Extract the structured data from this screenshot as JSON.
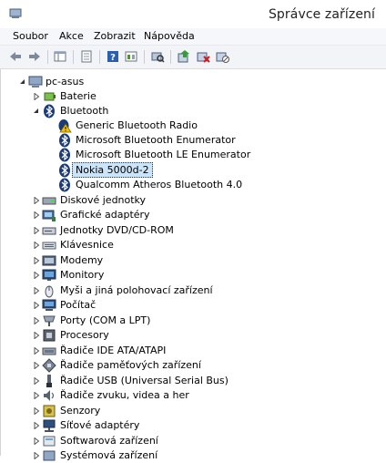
{
  "window": {
    "title": "Správce zařízení"
  },
  "menu": [
    "Soubor",
    "Akce",
    "Zobrazit",
    "Nápověda"
  ],
  "toolbar": {
    "buttons": [
      "back-icon",
      "forward-icon",
      "show-hide-tree-icon",
      "properties-icon",
      "help-icon",
      "action-view-icon",
      "scan-hardware-icon",
      "update-driver-icon",
      "uninstall-icon",
      "disable-icon"
    ]
  },
  "tree": {
    "root": "pc-asus",
    "items": [
      {
        "label": "Baterie",
        "icon": "battery-icon",
        "expanded": false
      },
      {
        "label": "Bluetooth",
        "icon": "bluetooth-icon",
        "expanded": true,
        "children": [
          {
            "label": "Generic Bluetooth Radio",
            "icon": "warning-icon"
          },
          {
            "label": "Microsoft Bluetooth Enumerator",
            "icon": "bluetooth-icon"
          },
          {
            "label": "Microsoft Bluetooth LE Enumerator",
            "icon": "bluetooth-icon"
          },
          {
            "label": "Nokia 5000d-2",
            "icon": "bluetooth-icon",
            "selected": true
          },
          {
            "label": "Qualcomm Atheros Bluetooth 4.0",
            "icon": "bluetooth-icon"
          }
        ]
      },
      {
        "label": "Diskové jednotky",
        "icon": "disk-icon",
        "expanded": false
      },
      {
        "label": "Grafické adaptéry",
        "icon": "display-adapter-icon",
        "expanded": false
      },
      {
        "label": "Jednotky DVD/CD-ROM",
        "icon": "dvd-icon",
        "expanded": false
      },
      {
        "label": "Klávesnice",
        "icon": "keyboard-icon",
        "expanded": false
      },
      {
        "label": "Modemy",
        "icon": "modem-icon",
        "expanded": false
      },
      {
        "label": "Monitory",
        "icon": "monitor-icon",
        "expanded": false
      },
      {
        "label": "Myši a jiná polohovací zařízení",
        "icon": "mouse-icon",
        "expanded": false
      },
      {
        "label": "Počítač",
        "icon": "computer-icon",
        "expanded": false
      },
      {
        "label": "Porty (COM a LPT)",
        "icon": "port-icon",
        "expanded": false
      },
      {
        "label": "Procesory",
        "icon": "processor-icon",
        "expanded": false
      },
      {
        "label": "Řadiče IDE ATA/ATAPI",
        "icon": "ide-controller-icon",
        "expanded": false
      },
      {
        "label": "Řadiče paměťových zařízení",
        "icon": "storage-controller-icon",
        "expanded": false
      },
      {
        "label": "Řadiče USB (Universal Serial Bus)",
        "icon": "usb-icon",
        "expanded": false
      },
      {
        "label": "Řadiče zvuku, videa a her",
        "icon": "sound-icon",
        "expanded": false
      },
      {
        "label": "Senzory",
        "icon": "sensor-icon",
        "expanded": false
      },
      {
        "label": "Síťové adaptéry",
        "icon": "network-adapter-icon",
        "expanded": false
      },
      {
        "label": "Softwarová zařízení",
        "icon": "software-device-icon",
        "expanded": false
      },
      {
        "label": "Systémová zařízení",
        "icon": "system-device-icon",
        "expanded": false
      }
    ]
  }
}
